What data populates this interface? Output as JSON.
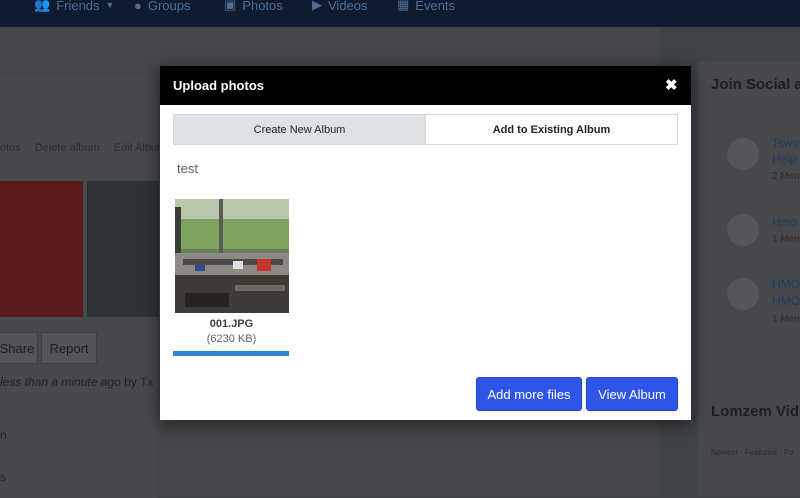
{
  "topnav": {
    "items": [
      {
        "label": "Friends",
        "icon": "users-icon"
      },
      {
        "label": "Groups",
        "icon": "group-icon"
      },
      {
        "label": "Photos",
        "icon": "photos-icon"
      },
      {
        "label": "Videos",
        "icon": "video-icon"
      },
      {
        "label": "Events",
        "icon": "calendar-icon"
      }
    ]
  },
  "background": {
    "tabs": [
      "otos",
      "Delete album",
      "Edit Album"
    ],
    "buttons": {
      "share": "Share",
      "report": "Report"
    },
    "meta": {
      "time": "less than a minute ago",
      "by": "by",
      "user": "Tx"
    },
    "side_letters": [
      "n",
      "s"
    ],
    "right_title": "Join Social a",
    "groups": [
      {
        "line1": "Tswv",
        "line2": "Help",
        "meta": "2 Mem"
      },
      {
        "line1": "Hmo",
        "line2": "",
        "meta": "1 Mem"
      },
      {
        "line1": "HMO",
        "line2": "HMO",
        "meta": "1 Mem"
      }
    ],
    "lomzem_title": "Lomzem Vid",
    "lomzem_tabs": "Newest · Featured · Po"
  },
  "modal": {
    "title": "Upload photos",
    "close_glyph": "✖",
    "tabs": {
      "create": "Create New Album",
      "existing": "Add to Existing Album"
    },
    "album_name": "test",
    "file": {
      "name": "001.JPG",
      "size": "(6230 KB)",
      "progress": 1.0
    },
    "buttons": {
      "add_more": "Add more files",
      "view_album": "View Album"
    }
  },
  "colors": {
    "accent": "#2f55e8",
    "progress": "#2e86d6",
    "header": "#000000"
  }
}
